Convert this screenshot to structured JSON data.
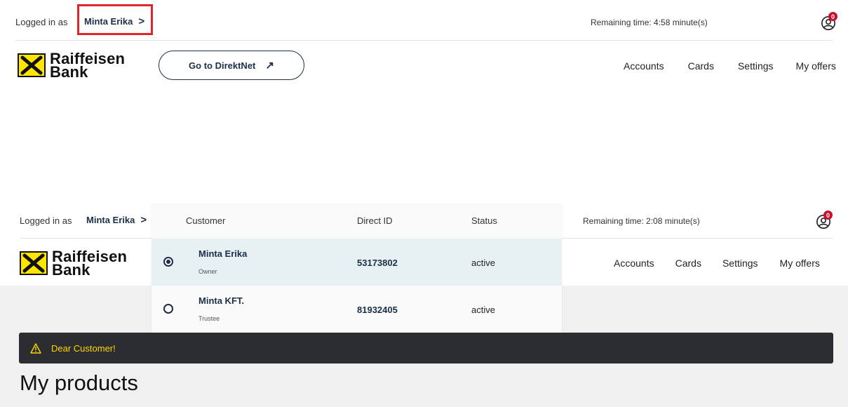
{
  "header1": {
    "logged_in_label": "Logged in as",
    "user_name": "Minta Erika",
    "chevron": ">",
    "remaining_label": "Remaining time:",
    "remaining_value": "4:58 minute(s)",
    "badge_count": "0"
  },
  "brand": {
    "line1": "Raiffeisen",
    "line2": "Bank"
  },
  "direktnet": {
    "label": "Go to DirektNet",
    "arrow": "↗"
  },
  "nav": {
    "accounts": "Accounts",
    "cards": "Cards",
    "settings": "Settings",
    "offers": "My offers"
  },
  "header2": {
    "logged_in_label": "Logged in as",
    "user_name": "Minta Erika",
    "chevron": ">",
    "remaining_label": "Remaining time:",
    "remaining_value": "2:08 minute(s)",
    "badge_count": "0"
  },
  "customer_table": {
    "headers": {
      "customer": "Customer",
      "direct_id": "Direct ID",
      "status": "Status"
    },
    "rows": [
      {
        "name": "Minta Erika",
        "role": "Owner",
        "direct_id": "53173802",
        "status": "active",
        "selected": true
      },
      {
        "name": "Minta KFT.",
        "role": "Trustee",
        "direct_id": "81932405",
        "status": "active",
        "selected": false
      }
    ]
  },
  "alert": {
    "icon": "warning-icon",
    "text": "Dear Customer!"
  },
  "page": {
    "title": "My products"
  },
  "colors": {
    "brand_yellow": "#ffe600",
    "navy": "#1b2f4a",
    "highlight_red": "#e0252c",
    "alert_bg": "#2b2d31"
  }
}
